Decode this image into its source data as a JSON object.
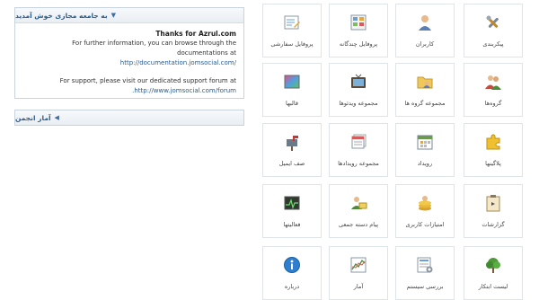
{
  "welcome_panel": {
    "header": "به جامعه مجازی خوش آمدید",
    "thanks": "Thanks for Azrul.com",
    "line1": "For further information, you can browse through the documentations at",
    "doc_link": "http://documentation.jomsocial.com/",
    "line2": "For support, please visit our dedicated support forum at",
    "forum_link": ".http://www.jomsocial.com/forum"
  },
  "stats_panel": {
    "header": "آمار انجمن"
  },
  "tiles": [
    {
      "label": "پیکربندی",
      "icon": "tools-icon"
    },
    {
      "label": "کاربران",
      "icon": "user-icon"
    },
    {
      "label": "پروفایل چندگانه",
      "icon": "multiprofile-icon"
    },
    {
      "label": "پروفایل سفارشی",
      "icon": "custom-profile-icon"
    },
    {
      "label": "گروه‌ها",
      "icon": "groups-icon"
    },
    {
      "label": "مجموعه گروه ها",
      "icon": "group-category-icon"
    },
    {
      "label": "مجموعه ویدئوها",
      "icon": "video-category-icon"
    },
    {
      "label": "قالبها",
      "icon": "templates-icon"
    },
    {
      "label": "پلاگینها",
      "icon": "plugins-icon"
    },
    {
      "label": "رویداد",
      "icon": "event-icon"
    },
    {
      "label": "مجموعه رویدادها",
      "icon": "event-category-icon"
    },
    {
      "label": "صف ایمیل",
      "icon": "mailbox-icon"
    },
    {
      "label": "گزارشات",
      "icon": "reports-icon"
    },
    {
      "label": "امتیازات کاربری",
      "icon": "userpoints-icon"
    },
    {
      "label": "پیام دسته جمعی",
      "icon": "mass-message-icon"
    },
    {
      "label": "فعالیتها",
      "icon": "activities-icon"
    },
    {
      "label": "لیست ابتکار",
      "icon": "tree-icon"
    },
    {
      "label": "بررسی سیستم",
      "icon": "system-check-icon"
    },
    {
      "label": "آمار",
      "icon": "statistics-icon"
    },
    {
      "label": "درباره",
      "icon": "info-icon"
    }
  ]
}
